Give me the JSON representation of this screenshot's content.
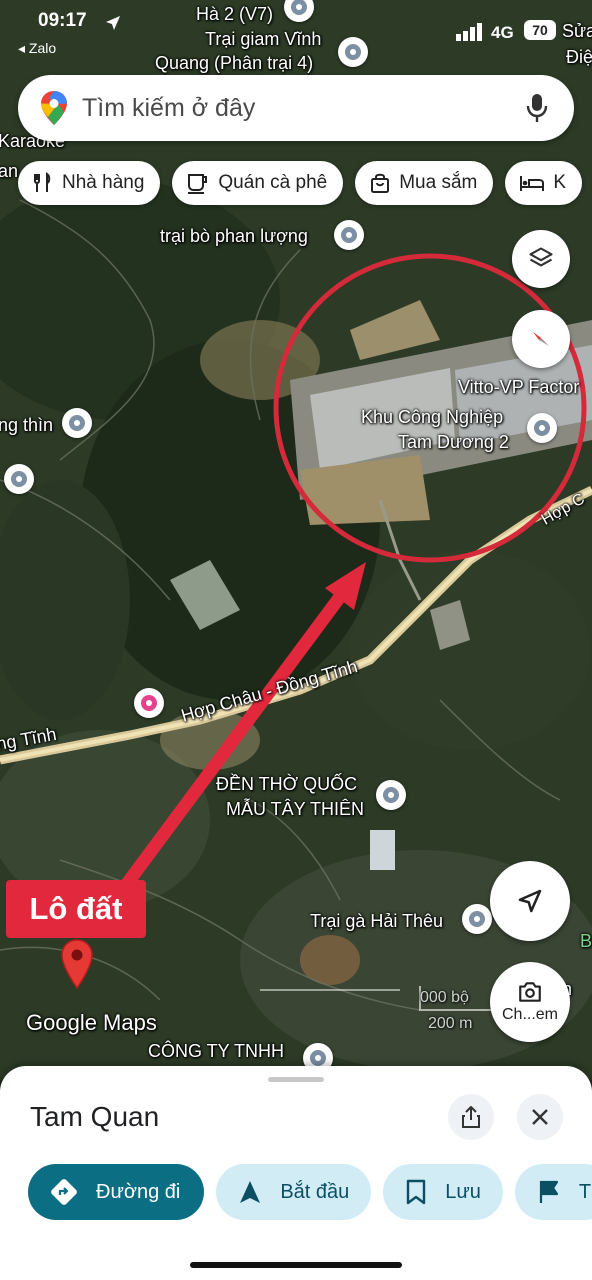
{
  "status_bar": {
    "time": "09:17",
    "back_app": "◂ Zalo",
    "network": "4G",
    "battery": "70"
  },
  "search": {
    "placeholder": "Tìm kiếm ở đây"
  },
  "chips": [
    {
      "label": "Nhà hàng",
      "icon": "fork-knife-icon"
    },
    {
      "label": "Quán cà phê",
      "icon": "coffee-icon"
    },
    {
      "label": "Mua sắm",
      "icon": "shopping-bag-icon"
    },
    {
      "label": "K",
      "icon": "hotel-bed-icon"
    }
  ],
  "map": {
    "labels": {
      "ha2": "Hà 2 (V7)",
      "prison1": "Trại giam Vĩnh",
      "prison2": "Quang (Phân trại 4)",
      "sua": "Sửa",
      "dien": "Điệ",
      "karaoke": "Karaoke",
      "an": "an",
      "trai_bo": "trại bò phan lượng",
      "vitto": "Vitto-VP Factor",
      "kcn1": "Khu Công Nghiệp",
      "kcn2": "Tam Dương 2",
      "ng_thin": "ng thìn",
      "hop_c": "Hợp C",
      "hop_chau": "Hợp Châu - Đồng Tĩnh",
      "ng_tinh": "ng Tĩnh",
      "den_tho1": "ĐỀN THỜ QUỐC",
      "den_tho2": "MẪU TÂY THIÊN",
      "trai_ga": "Trại gà Hải Thêu",
      "b": "B",
      "n": "n",
      "cong_ty": "CÔNG TY TNHH",
      "scale_ft": "000 bộ",
      "scale_m": "200 m",
      "google_maps": "Google Maps",
      "lodat": "Lô đất",
      "ch_em": "Ch...em"
    }
  },
  "place": {
    "title": "Tam Quan",
    "actions": [
      {
        "label": "Đường đi",
        "icon": "directions-icon"
      },
      {
        "label": "Bắt đầu",
        "icon": "navigation-arrow-icon"
      },
      {
        "label": "Lưu",
        "icon": "bookmark-icon"
      },
      {
        "label": "T",
        "icon": "flag-icon"
      }
    ]
  },
  "colors": {
    "accent": "#0c6e83",
    "annotation_red": "#e2283c",
    "chip_bg": "#ffffff"
  }
}
